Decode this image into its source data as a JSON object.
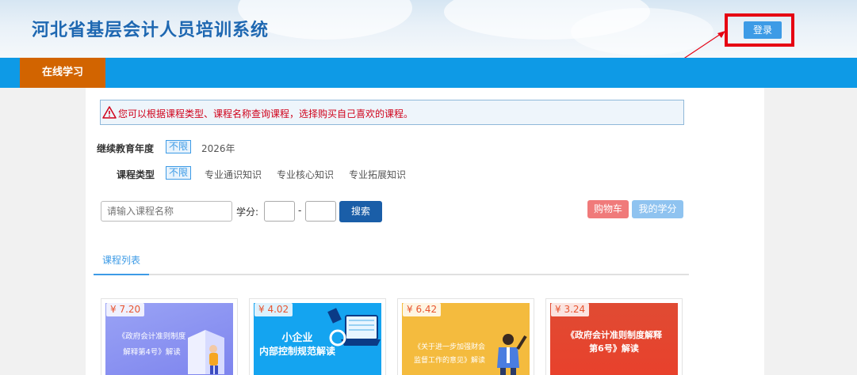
{
  "header": {
    "title": "河北省基层会计人员培训系统",
    "login_label": "登录"
  },
  "nav": {
    "items": [
      {
        "label": "在线学习"
      }
    ]
  },
  "notice": {
    "text": "您可以根据课程类型、课程名称查询课程，选择购买自己喜欢的课程。"
  },
  "filters": {
    "year": {
      "label": "继续教育年度",
      "options": [
        "不限",
        "2026年"
      ],
      "selected": "不限"
    },
    "type": {
      "label": "课程类型",
      "options": [
        "不限",
        "专业通识知识",
        "专业核心知识",
        "专业拓展知识"
      ],
      "selected": "不限"
    }
  },
  "search": {
    "placeholder": "请输入课程名称",
    "score_label": "学分:",
    "dash": "-",
    "button_label": "搜索",
    "cart_label": "购物车",
    "credits_label": "我的学分"
  },
  "tabs": [
    {
      "label": "课程列表"
    }
  ],
  "courses": [
    {
      "price": "¥ 7.20",
      "title_lines": [
        "《政府会计准则制度",
        "解释第4号》解读"
      ],
      "bg": "#8b93f2"
    },
    {
      "price": "¥ 4.02",
      "title_lines": [
        "小企业",
        "内部控制规范解读"
      ],
      "bg": "#14a4f0"
    },
    {
      "price": "¥ 6.42",
      "title_lines": [
        "《关于进一步加强财会",
        "监督工作的意见》解读"
      ],
      "bg": "#f4bb3e"
    },
    {
      "price": "¥ 3.24",
      "title_lines": [
        "《政府会计准则制度解释",
        "第6号》解读"
      ],
      "bg": "#e8412c"
    }
  ],
  "colors": {
    "brand_blue": "#0e9ae6",
    "nav_active": "#d26400",
    "title_blue": "#1d67b1",
    "highlight_red": "#e60012"
  }
}
